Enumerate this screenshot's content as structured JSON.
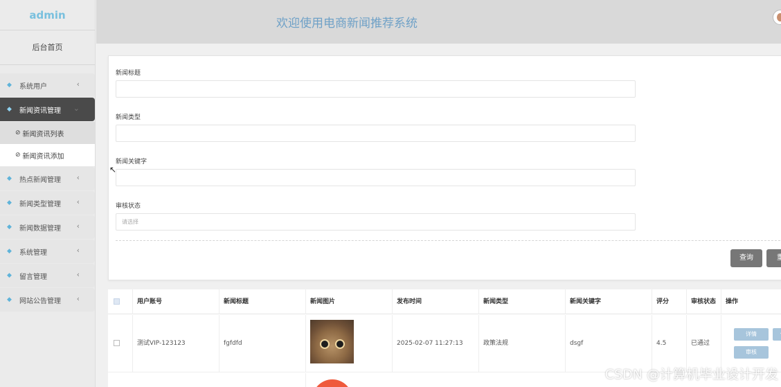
{
  "sidebar": {
    "brand": "admin",
    "home": "后台首页",
    "items": [
      {
        "label": "系统用户",
        "chevron": "‹"
      },
      {
        "label": "新闻资讯管理",
        "chevron": "⌄"
      },
      {
        "label": "热点新闻管理",
        "chevron": "‹"
      },
      {
        "label": "新闻类型管理",
        "chevron": "‹"
      },
      {
        "label": "新闻数据管理",
        "chevron": "‹"
      },
      {
        "label": "系统管理",
        "chevron": "‹"
      },
      {
        "label": "留言管理",
        "chevron": "‹"
      },
      {
        "label": "网站公告管理",
        "chevron": "‹"
      }
    ],
    "sub_items": [
      {
        "label": "新闻资讯列表"
      },
      {
        "label": "新闻资讯添加"
      }
    ]
  },
  "header": {
    "title": "欢迎使用电商新闻推荐系统"
  },
  "search": {
    "fields": [
      {
        "label": "新闻标题",
        "value": ""
      },
      {
        "label": "新闻类型",
        "value": ""
      },
      {
        "label": "新闻关键字",
        "value": ""
      },
      {
        "label": "审核状态",
        "placeholder": "请选择"
      }
    ],
    "query_button": "查询",
    "reset_button": "重"
  },
  "table": {
    "columns": [
      "用户账号",
      "新闻标题",
      "新闻图片",
      "发布时间",
      "新闻类型",
      "新闻关键字",
      "评分",
      "审核状态",
      "操作"
    ],
    "rows": [
      {
        "account": "测试VIP-123123",
        "title": "fgfdfd",
        "image": "cat-photo",
        "time": "2025-02-07 11:27:13",
        "type": "政策法规",
        "keyword": "dsgf",
        "score": "4.5",
        "status": "已通过",
        "actions": [
          "详情",
          "修",
          "审核"
        ]
      }
    ]
  },
  "watermark": "CSDN @计算机毕业设计开发",
  "colors": {
    "brand": "#79c0de",
    "title": "#6fa1c7",
    "active_nav": "#4a4a4a",
    "button": "#777777",
    "action_button": "#a7c5dc"
  }
}
